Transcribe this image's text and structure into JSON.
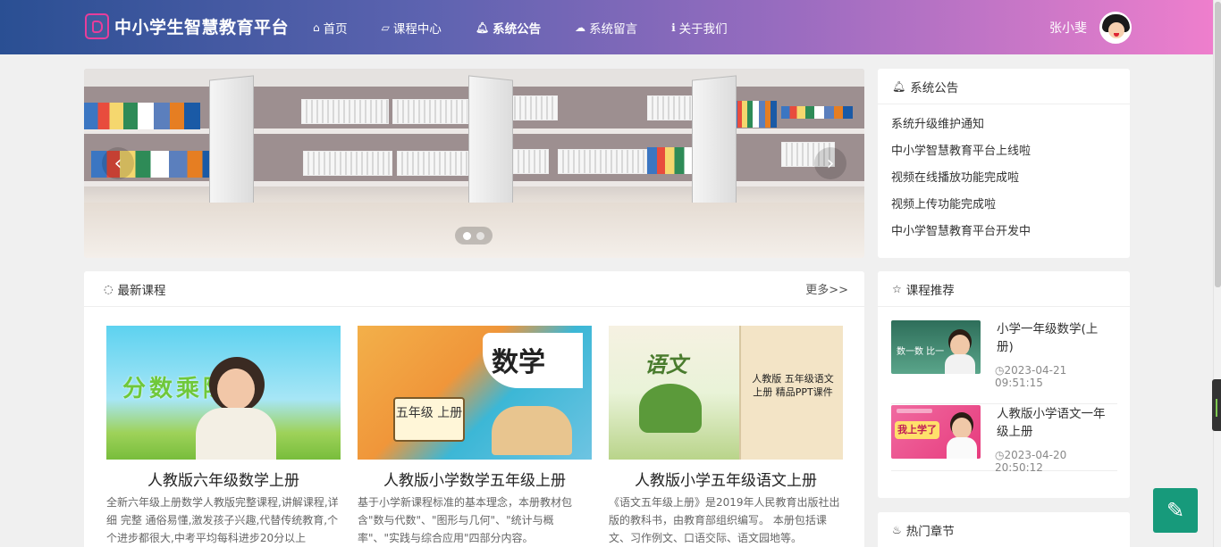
{
  "header": {
    "brand": "中小学生智慧教育平台",
    "nav": [
      {
        "icon": "home-icon",
        "glyph": "⌂",
        "label": "首页"
      },
      {
        "icon": "book-icon",
        "glyph": "▱",
        "label": "课程中心"
      },
      {
        "icon": "bell-icon",
        "glyph": "♫",
        "label": "系统公告"
      },
      {
        "icon": "chat-icon",
        "glyph": "☁",
        "label": "系统留言"
      },
      {
        "icon": "info-icon",
        "glyph": "ℹ",
        "label": "关于我们"
      }
    ],
    "active_nav": "系统公告",
    "user_name": "张小斐"
  },
  "carousel": {
    "prev": "‹",
    "next": "›",
    "slides": 2,
    "active_slide": 1
  },
  "notices": {
    "title": "系统公告",
    "items": [
      "系统升级维护通知",
      "中小学智慧教育平台上线啦",
      "视频在线播放功能完成啦",
      "视频上传功能完成啦",
      "中小学智慧教育平台开发中"
    ]
  },
  "latest_courses": {
    "title": "最新课程",
    "more": "更多>>",
    "items": [
      {
        "thumb_text": "分数乘除法",
        "title": "人教版六年级数学上册",
        "desc": "全新六年级上册数学人教版完整课程,讲解课程,详细 完整 通俗易懂,激发孩子兴趣,代替传统教育,个个进步都很大,中考平均每科进步20分以上"
      },
      {
        "thumb_text": "数学",
        "thumb_sub": "五年级 上册",
        "title": "人教版小学数学五年级上册",
        "desc": "基于小学新课程标准的基本理念，本册教材包含\"数与代数\"、\"图形与几何\"、\"统计与概率\"、\"实践与综合应用\"四部分内容。"
      },
      {
        "thumb_text": "语文",
        "thumb_sub": "人教版 五年级语文上册 精品PPT课件",
        "title": "人教版小学五年级语文上册",
        "desc": "《语文五年级上册》是2019年人民教育出版社出版的教科书，由教育部组织编写。 本册包括课文、习作例文、口语交际、语文园地等。"
      }
    ]
  },
  "recommend": {
    "title": "课程推荐",
    "items": [
      {
        "thumb_text": "数一数 比一",
        "title": "小学一年级数学(上册)",
        "time": "2023-04-21 09:51:15"
      },
      {
        "thumb_text": "我上学了",
        "title": "人教版小学语文一年级上册",
        "time": "2023-04-20 20:50:12"
      }
    ]
  },
  "hot_chapters": {
    "title": "热门章节"
  },
  "colors": {
    "accent": "#179a7b",
    "brand_pink": "#e83d9b"
  }
}
